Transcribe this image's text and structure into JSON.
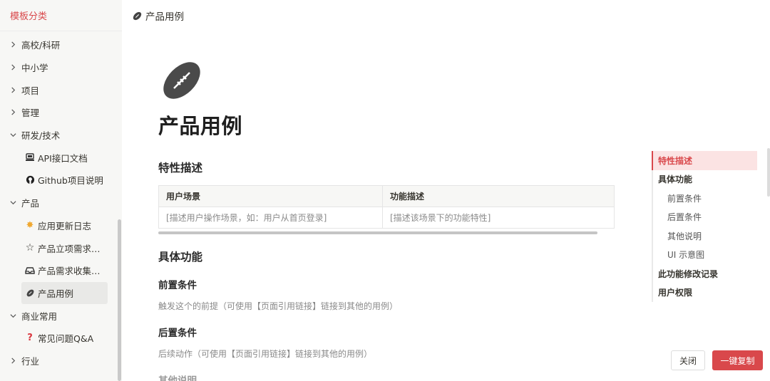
{
  "sidebar": {
    "header": "模板分类",
    "items": [
      {
        "label": "高校/科研",
        "type": "top",
        "expanded": false
      },
      {
        "label": "中小学",
        "type": "top",
        "expanded": false
      },
      {
        "label": "项目",
        "type": "top",
        "expanded": false
      },
      {
        "label": "管理",
        "type": "top",
        "expanded": false
      },
      {
        "label": "研发/技术",
        "type": "top",
        "expanded": true
      },
      {
        "label": "API接口文档",
        "type": "child",
        "icon": "laptop-icon"
      },
      {
        "label": "Github项目说明",
        "type": "child",
        "icon": "github-icon"
      },
      {
        "label": "产品",
        "type": "top",
        "expanded": true
      },
      {
        "label": "应用更新日志",
        "type": "child",
        "icon": "sparkle-icon"
      },
      {
        "label": "产品立项需求…",
        "type": "child",
        "icon": "star-outline-icon"
      },
      {
        "label": "产品需求收集…",
        "type": "child",
        "icon": "inbox-icon"
      },
      {
        "label": "产品用例",
        "type": "child",
        "icon": "football-icon",
        "active": true
      },
      {
        "label": "商业常用",
        "type": "top",
        "expanded": true
      },
      {
        "label": "常见问题Q&A",
        "type": "child",
        "icon": "question-icon"
      },
      {
        "label": "行业",
        "type": "top",
        "expanded": false
      }
    ]
  },
  "topbar": {
    "title": "产品用例",
    "icon": "football-icon"
  },
  "page": {
    "title": "产品用例",
    "section1": "特性描述",
    "table": {
      "headers": [
        "用户场景",
        "功能描述"
      ],
      "rows": [
        [
          "[描述用户操作场景，如：用户从首页登录]",
          "[描述该场景下的功能特性]"
        ]
      ]
    },
    "section2": "具体功能",
    "pre_title": "前置条件",
    "pre_text": "触发这个的前提（可使用【页面引用链接】链接到其他的用例）",
    "post_title": "后置条件",
    "post_text": "后续动作（可使用【页面引用链接】链接到其他的用例）",
    "other_title": "其他说明"
  },
  "outline": [
    {
      "label": "特性描述",
      "level": 1,
      "active": true
    },
    {
      "label": "具体功能",
      "level": 1
    },
    {
      "label": "前置条件",
      "level": 2
    },
    {
      "label": "后置条件",
      "level": 2
    },
    {
      "label": "其他说明",
      "level": 2
    },
    {
      "label": "UI 示意图",
      "level": 2
    },
    {
      "label": "此功能修改记录",
      "level": 1
    },
    {
      "label": "用户权限",
      "level": 1
    }
  ],
  "buttons": {
    "close": "关闭",
    "copy": "一键复制"
  },
  "colors": {
    "accent": "#d9484b",
    "active_bg": "#fbe3e3"
  }
}
